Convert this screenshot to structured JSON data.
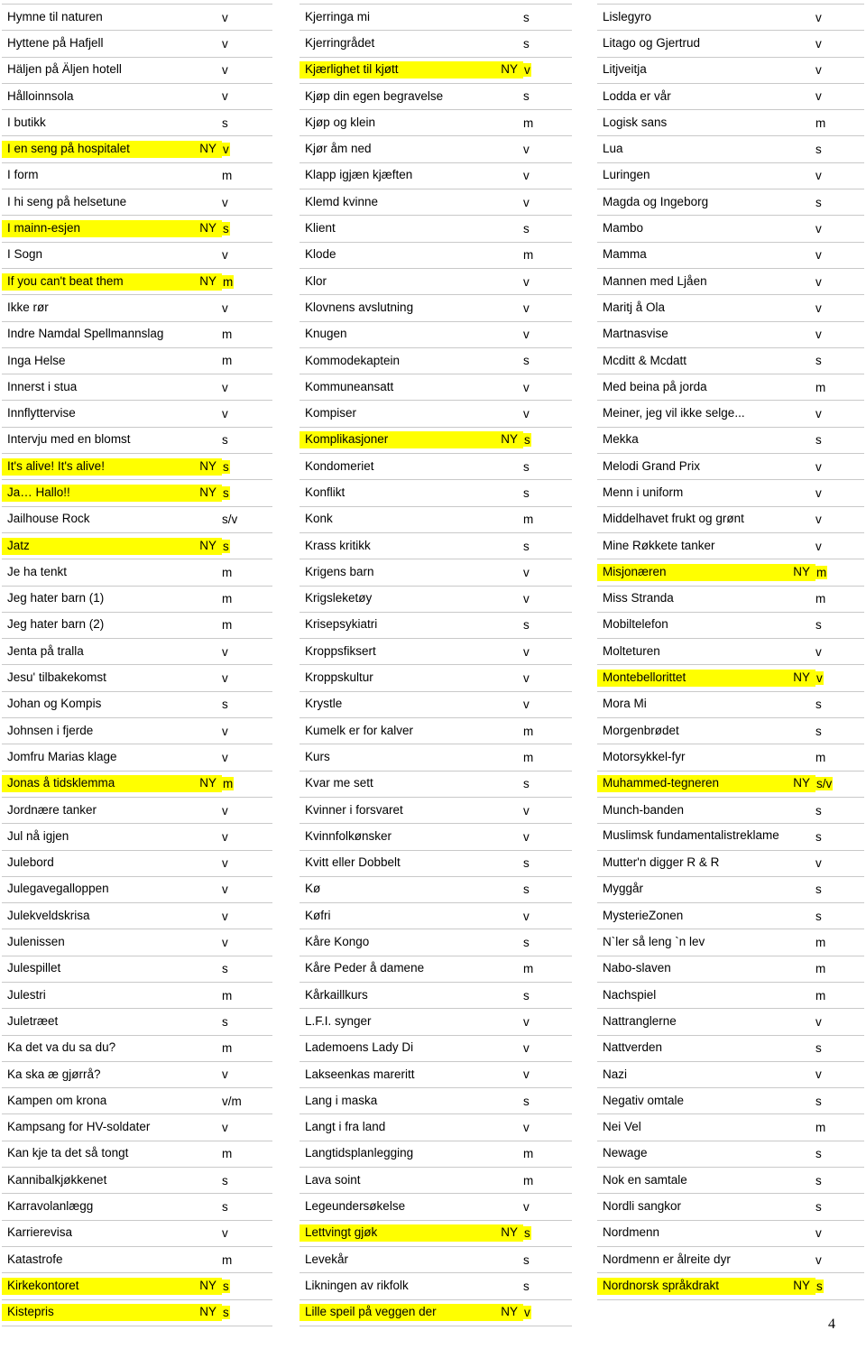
{
  "document": {
    "page_number": "4",
    "highlight_color": "#ffff00",
    "new_marker": "NY"
  },
  "columns": [
    {
      "name": "column-1",
      "rows": [
        {
          "title": "Hymne til naturen",
          "ny": "",
          "cat": "v",
          "hl": false
        },
        {
          "title": "Hyttene på Hafjell",
          "ny": "",
          "cat": "v",
          "hl": false
        },
        {
          "title": "Häljen på Äljen hotell",
          "ny": "",
          "cat": "v",
          "hl": false
        },
        {
          "title": "Hålloinnsola",
          "ny": "",
          "cat": "v",
          "hl": false
        },
        {
          "title": "I butikk",
          "ny": "",
          "cat": "s",
          "hl": false
        },
        {
          "title": "I en seng på hospitalet",
          "ny": "NY",
          "cat": "v",
          "hl": true
        },
        {
          "title": "I form",
          "ny": "",
          "cat": "m",
          "hl": false
        },
        {
          "title": "I hi seng på helsetune",
          "ny": "",
          "cat": "v",
          "hl": false
        },
        {
          "title": "I mainn-esjen",
          "ny": "NY",
          "cat": "s",
          "hl": true
        },
        {
          "title": "I Sogn",
          "ny": "",
          "cat": "v",
          "hl": false
        },
        {
          "title": "If you can't beat them",
          "ny": "NY",
          "cat": "m",
          "hl": true
        },
        {
          "title": "Ikke rør",
          "ny": "",
          "cat": "v",
          "hl": false
        },
        {
          "title": "Indre Namdal Spellmannslag",
          "ny": "",
          "cat": "m",
          "hl": false
        },
        {
          "title": "Inga Helse",
          "ny": "",
          "cat": "m",
          "hl": false
        },
        {
          "title": "Innerst i stua",
          "ny": "",
          "cat": "v",
          "hl": false
        },
        {
          "title": "Innflyttervise",
          "ny": "",
          "cat": "v",
          "hl": false
        },
        {
          "title": "Intervju med en blomst",
          "ny": "",
          "cat": "s",
          "hl": false
        },
        {
          "title": "It's alive! It's alive!",
          "ny": "NY",
          "cat": "s",
          "hl": true
        },
        {
          "title": "Ja… Hallo!!",
          "ny": "NY",
          "cat": "s",
          "hl": true
        },
        {
          "title": "Jailhouse Rock",
          "ny": "",
          "cat": "s/v",
          "hl": false
        },
        {
          "title": "Jatz",
          "ny": "NY",
          "cat": "s",
          "hl": true
        },
        {
          "title": "Je ha tenkt",
          "ny": "",
          "cat": "m",
          "hl": false
        },
        {
          "title": "Jeg hater barn (1)",
          "ny": "",
          "cat": "m",
          "hl": false
        },
        {
          "title": "Jeg hater barn (2)",
          "ny": "",
          "cat": "m",
          "hl": false
        },
        {
          "title": "Jenta på tralla",
          "ny": "",
          "cat": "v",
          "hl": false
        },
        {
          "title": "Jesu' tilbakekomst",
          "ny": "",
          "cat": "v",
          "hl": false
        },
        {
          "title": "Johan og Kompis",
          "ny": "",
          "cat": "s",
          "hl": false
        },
        {
          "title": "Johnsen i fjerde",
          "ny": "",
          "cat": "v",
          "hl": false
        },
        {
          "title": "Jomfru Marias klage",
          "ny": "",
          "cat": "v",
          "hl": false
        },
        {
          "title": "Jonas å tidsklemma",
          "ny": "NY",
          "cat": "m",
          "hl": true
        },
        {
          "title": "Jordnære tanker",
          "ny": "",
          "cat": "v",
          "hl": false
        },
        {
          "title": "Jul nå igjen",
          "ny": "",
          "cat": "v",
          "hl": false
        },
        {
          "title": "Julebord",
          "ny": "",
          "cat": "v",
          "hl": false
        },
        {
          "title": "Julegavegalloppen",
          "ny": "",
          "cat": "v",
          "hl": false
        },
        {
          "title": "Julekveldskrisa",
          "ny": "",
          "cat": "v",
          "hl": false
        },
        {
          "title": "Julenissen",
          "ny": "",
          "cat": "v",
          "hl": false
        },
        {
          "title": "Julespillet",
          "ny": "",
          "cat": "s",
          "hl": false
        },
        {
          "title": "Julestri",
          "ny": "",
          "cat": "m",
          "hl": false
        },
        {
          "title": "Juletræet",
          "ny": "",
          "cat": "s",
          "hl": false
        },
        {
          "title": "Ka det va du sa du?",
          "ny": "",
          "cat": "m",
          "hl": false
        },
        {
          "title": "Ka ska æ gjørrå?",
          "ny": "",
          "cat": "v",
          "hl": false
        },
        {
          "title": "Kampen om krona",
          "ny": "",
          "cat": "v/m",
          "hl": false
        },
        {
          "title": "Kampsang for HV-soldater",
          "ny": "",
          "cat": "v",
          "hl": false
        },
        {
          "title": "Kan kje ta det så tongt",
          "ny": "",
          "cat": "m",
          "hl": false
        },
        {
          "title": "Kannibalkjøkkenet",
          "ny": "",
          "cat": "s",
          "hl": false
        },
        {
          "title": "Karravolanlægg",
          "ny": "",
          "cat": "s",
          "hl": false
        },
        {
          "title": "Karrierevisa",
          "ny": "",
          "cat": "v",
          "hl": false
        },
        {
          "title": "Katastrofe",
          "ny": "",
          "cat": "m",
          "hl": false
        },
        {
          "title": "Kirkekontoret",
          "ny": "NY",
          "cat": "s",
          "hl": true
        },
        {
          "title": "Kistepris",
          "ny": "NY",
          "cat": "s",
          "hl": true
        }
      ]
    },
    {
      "name": "column-2",
      "rows": [
        {
          "title": "Kjerringa mi",
          "ny": "",
          "cat": "s",
          "hl": false
        },
        {
          "title": "Kjerringrådet",
          "ny": "",
          "cat": "s",
          "hl": false
        },
        {
          "title": "Kjærlighet til kjøtt",
          "ny": "NY",
          "cat": "v",
          "hl": true
        },
        {
          "title": "Kjøp din egen begravelse",
          "ny": "",
          "cat": "s",
          "hl": false
        },
        {
          "title": "Kjøp og klein",
          "ny": "",
          "cat": "m",
          "hl": false
        },
        {
          "title": "Kjør åm ned",
          "ny": "",
          "cat": "v",
          "hl": false
        },
        {
          "title": "Klapp igjæn kjæften",
          "ny": "",
          "cat": "v",
          "hl": false
        },
        {
          "title": "Klemd kvinne",
          "ny": "",
          "cat": "v",
          "hl": false
        },
        {
          "title": "Klient",
          "ny": "",
          "cat": "s",
          "hl": false
        },
        {
          "title": "Klode",
          "ny": "",
          "cat": "m",
          "hl": false
        },
        {
          "title": "Klor",
          "ny": "",
          "cat": "v",
          "hl": false
        },
        {
          "title": "Klovnens avslutning",
          "ny": "",
          "cat": "v",
          "hl": false
        },
        {
          "title": "Knugen",
          "ny": "",
          "cat": "v",
          "hl": false
        },
        {
          "title": "Kommodekaptein",
          "ny": "",
          "cat": "s",
          "hl": false
        },
        {
          "title": "Kommuneansatt",
          "ny": "",
          "cat": "v",
          "hl": false
        },
        {
          "title": "Kompiser",
          "ny": "",
          "cat": "v",
          "hl": false
        },
        {
          "title": "Komplikasjoner",
          "ny": "NY",
          "cat": "s",
          "hl": true
        },
        {
          "title": "Kondomeriet",
          "ny": "",
          "cat": "s",
          "hl": false
        },
        {
          "title": "Konflikt",
          "ny": "",
          "cat": "s",
          "hl": false
        },
        {
          "title": "Konk",
          "ny": "",
          "cat": "m",
          "hl": false
        },
        {
          "title": "Krass kritikk",
          "ny": "",
          "cat": "s",
          "hl": false
        },
        {
          "title": "Krigens barn",
          "ny": "",
          "cat": "v",
          "hl": false
        },
        {
          "title": "Krigsleketøy",
          "ny": "",
          "cat": "v",
          "hl": false
        },
        {
          "title": "Krisepsykiatri",
          "ny": "",
          "cat": "s",
          "hl": false
        },
        {
          "title": "Kroppsfiksert",
          "ny": "",
          "cat": "v",
          "hl": false
        },
        {
          "title": "Kroppskultur",
          "ny": "",
          "cat": "v",
          "hl": false
        },
        {
          "title": "Krystle",
          "ny": "",
          "cat": "v",
          "hl": false
        },
        {
          "title": "Kumelk er for kalver",
          "ny": "",
          "cat": "m",
          "hl": false
        },
        {
          "title": "Kurs",
          "ny": "",
          "cat": "m",
          "hl": false
        },
        {
          "title": "Kvar me sett",
          "ny": "",
          "cat": "s",
          "hl": false
        },
        {
          "title": "Kvinner i forsvaret",
          "ny": "",
          "cat": "v",
          "hl": false
        },
        {
          "title": "Kvinnfolkønsker",
          "ny": "",
          "cat": "v",
          "hl": false
        },
        {
          "title": "Kvitt eller Dobbelt",
          "ny": "",
          "cat": "s",
          "hl": false
        },
        {
          "title": "Kø",
          "ny": "",
          "cat": "s",
          "hl": false
        },
        {
          "title": "Køfri",
          "ny": "",
          "cat": "v",
          "hl": false
        },
        {
          "title": "Kåre Kongo",
          "ny": "",
          "cat": "s",
          "hl": false
        },
        {
          "title": "Kåre Peder å damene",
          "ny": "",
          "cat": "m",
          "hl": false
        },
        {
          "title": "Kårkaillkurs",
          "ny": "",
          "cat": "s",
          "hl": false
        },
        {
          "title": "L.F.I. synger",
          "ny": "",
          "cat": "v",
          "hl": false
        },
        {
          "title": "Lademoens Lady Di",
          "ny": "",
          "cat": "v",
          "hl": false
        },
        {
          "title": "Lakseenkas mareritt",
          "ny": "",
          "cat": "v",
          "hl": false
        },
        {
          "title": "Lang i maska",
          "ny": "",
          "cat": "s",
          "hl": false
        },
        {
          "title": "Langt i fra land",
          "ny": "",
          "cat": "v",
          "hl": false
        },
        {
          "title": "Langtidsplanlegging",
          "ny": "",
          "cat": "m",
          "hl": false
        },
        {
          "title": "Lava soint",
          "ny": "",
          "cat": "m",
          "hl": false
        },
        {
          "title": "Legeundersøkelse",
          "ny": "",
          "cat": "v",
          "hl": false
        },
        {
          "title": "Lettvingt gjøk",
          "ny": "NY",
          "cat": "s",
          "hl": true
        },
        {
          "title": "Levekår",
          "ny": "",
          "cat": "s",
          "hl": false
        },
        {
          "title": "Likningen av rikfolk",
          "ny": "",
          "cat": "s",
          "hl": false
        },
        {
          "title": "Lille speil på veggen der",
          "ny": "NY",
          "cat": "v",
          "hl": true
        }
      ]
    },
    {
      "name": "column-3",
      "rows": [
        {
          "title": "Lislegyro",
          "ny": "",
          "cat": "v",
          "hl": false
        },
        {
          "title": "Litago og Gjertrud",
          "ny": "",
          "cat": "v",
          "hl": false
        },
        {
          "title": "Litjveitja",
          "ny": "",
          "cat": "v",
          "hl": false
        },
        {
          "title": "Lodda er vår",
          "ny": "",
          "cat": "v",
          "hl": false
        },
        {
          "title": "Logisk sans",
          "ny": "",
          "cat": "m",
          "hl": false
        },
        {
          "title": "Lua",
          "ny": "",
          "cat": "s",
          "hl": false
        },
        {
          "title": "Luringen",
          "ny": "",
          "cat": "v",
          "hl": false
        },
        {
          "title": "Magda og Ingeborg",
          "ny": "",
          "cat": "s",
          "hl": false
        },
        {
          "title": "Mambo",
          "ny": "",
          "cat": "v",
          "hl": false
        },
        {
          "title": "Mamma",
          "ny": "",
          "cat": "v",
          "hl": false
        },
        {
          "title": "Mannen med Ljåen",
          "ny": "",
          "cat": "v",
          "hl": false
        },
        {
          "title": "Maritj å Ola",
          "ny": "",
          "cat": "v",
          "hl": false
        },
        {
          "title": "Martnasvise",
          "ny": "",
          "cat": "v",
          "hl": false
        },
        {
          "title": "Mcditt & Mcdatt",
          "ny": "",
          "cat": "s",
          "hl": false
        },
        {
          "title": "Med beina på jorda",
          "ny": "",
          "cat": "m",
          "hl": false
        },
        {
          "title": "Meiner, jeg vil ikke selge...",
          "ny": "",
          "cat": "v",
          "hl": false
        },
        {
          "title": "Mekka",
          "ny": "",
          "cat": "s",
          "hl": false
        },
        {
          "title": "Melodi Grand Prix",
          "ny": "",
          "cat": "v",
          "hl": false
        },
        {
          "title": "Menn i uniform",
          "ny": "",
          "cat": "v",
          "hl": false
        },
        {
          "title": "Middelhavet frukt og grønt",
          "ny": "",
          "cat": "v",
          "hl": false
        },
        {
          "title": "Mine Røkkete tanker",
          "ny": "",
          "cat": "v",
          "hl": false
        },
        {
          "title": "Misjonæren",
          "ny": "NY",
          "cat": "m",
          "hl": true
        },
        {
          "title": "Miss Stranda",
          "ny": "",
          "cat": "m",
          "hl": false
        },
        {
          "title": "Mobiltelefon",
          "ny": "",
          "cat": "s",
          "hl": false
        },
        {
          "title": "Molteturen",
          "ny": "",
          "cat": "v",
          "hl": false
        },
        {
          "title": "Montebellorittet",
          "ny": "NY",
          "cat": "v",
          "hl": true
        },
        {
          "title": "Mora Mi",
          "ny": "",
          "cat": "s",
          "hl": false
        },
        {
          "title": "Morgenbrødet",
          "ny": "",
          "cat": "s",
          "hl": false
        },
        {
          "title": "Motorsykkel-fyr",
          "ny": "",
          "cat": "m",
          "hl": false
        },
        {
          "title": "Muhammed-tegneren",
          "ny": "NY",
          "cat": "s/v",
          "hl": true
        },
        {
          "title": "Munch-banden",
          "ny": "",
          "cat": "s",
          "hl": false
        },
        {
          "title": "Muslimsk fundamentalistreklame",
          "ny": "",
          "cat": "s",
          "hl": false,
          "tall": true
        },
        {
          "title": "Mutter'n digger R & R",
          "ny": "",
          "cat": "v",
          "hl": false
        },
        {
          "title": "Myggår",
          "ny": "",
          "cat": "s",
          "hl": false
        },
        {
          "title": "MysterieZonen",
          "ny": "",
          "cat": "s",
          "hl": false
        },
        {
          "title": "N`ler så leng `n lev",
          "ny": "",
          "cat": "m",
          "hl": false
        },
        {
          "title": "Nabo-slaven",
          "ny": "",
          "cat": "m",
          "hl": false
        },
        {
          "title": "Nachspiel",
          "ny": "",
          "cat": "m",
          "hl": false
        },
        {
          "title": "Nattranglerne",
          "ny": "",
          "cat": "v",
          "hl": false
        },
        {
          "title": "Nattverden",
          "ny": "",
          "cat": "s",
          "hl": false
        },
        {
          "title": "Nazi",
          "ny": "",
          "cat": "v",
          "hl": false
        },
        {
          "title": "Negativ omtale",
          "ny": "",
          "cat": "s",
          "hl": false
        },
        {
          "title": "Nei Vel",
          "ny": "",
          "cat": "m",
          "hl": false
        },
        {
          "title": "Newage",
          "ny": "",
          "cat": "s",
          "hl": false
        },
        {
          "title": "Nok en samtale",
          "ny": "",
          "cat": "s",
          "hl": false
        },
        {
          "title": "Nordli sangkor",
          "ny": "",
          "cat": "s",
          "hl": false
        },
        {
          "title": "Nordmenn",
          "ny": "",
          "cat": "v",
          "hl": false
        },
        {
          "title": "Nordmenn er ålreite dyr",
          "ny": "",
          "cat": "v",
          "hl": false
        },
        {
          "title": "Nordnorsk språkdrakt",
          "ny": "NY",
          "cat": "s",
          "hl": true
        }
      ]
    }
  ]
}
